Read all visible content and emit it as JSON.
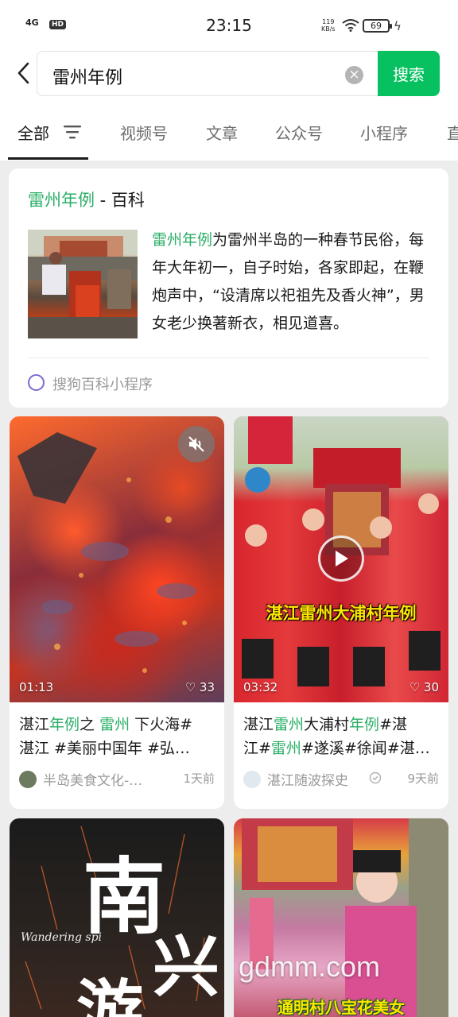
{
  "status_bar": {
    "signal": "4G",
    "hd": "HD",
    "time": "23:15",
    "net_speed_value": "119",
    "net_speed_unit": "KB/s",
    "battery": "69"
  },
  "search": {
    "query": "雷州年例",
    "button_label": "搜索"
  },
  "tabs": [
    {
      "label": "全部"
    },
    {
      "label": "视频号"
    },
    {
      "label": "文章"
    },
    {
      "label": "公众号"
    },
    {
      "label": "小程序"
    },
    {
      "label": "直"
    }
  ],
  "baike": {
    "title_keyword": "雷州年例",
    "title_suffix": " - 百科",
    "desc_keyword": "雷州年例",
    "desc_text": "为雷州半岛的一种春节民俗，每年大年初一，自子时始，各家即起，在鞭炮声中，“设清席以祀祖先及香火神”，男女老少换著新衣，相见道喜。",
    "source": "搜狗百科小程序"
  },
  "videos": [
    {
      "duration": "01:13",
      "likes": "33",
      "title_parts": [
        "湛江",
        "年例",
        "之 ",
        "雷州",
        " 下火海#"
      ],
      "title_line2": "湛江 #美丽中国年 #弘…",
      "author": "半岛美食文化-…",
      "ago": "1天前"
    },
    {
      "duration": "03:32",
      "likes": "30",
      "caption": "湛江雷州大浦村年例",
      "title_parts": [
        "湛江",
        "雷州",
        "大浦村",
        "年例",
        "#湛"
      ],
      "title_line2_parts": [
        "江#",
        "雷州",
        "#遂溪#徐闻#湛…"
      ],
      "author": "湛江随波探史",
      "ago": "9天前"
    },
    {
      "big_text": [
        "南",
        "兴",
        "游"
      ],
      "script_text": "Wandering spi"
    },
    {
      "caption": "通明村八宝花美女"
    }
  ],
  "watermark": "gdmm.com"
}
